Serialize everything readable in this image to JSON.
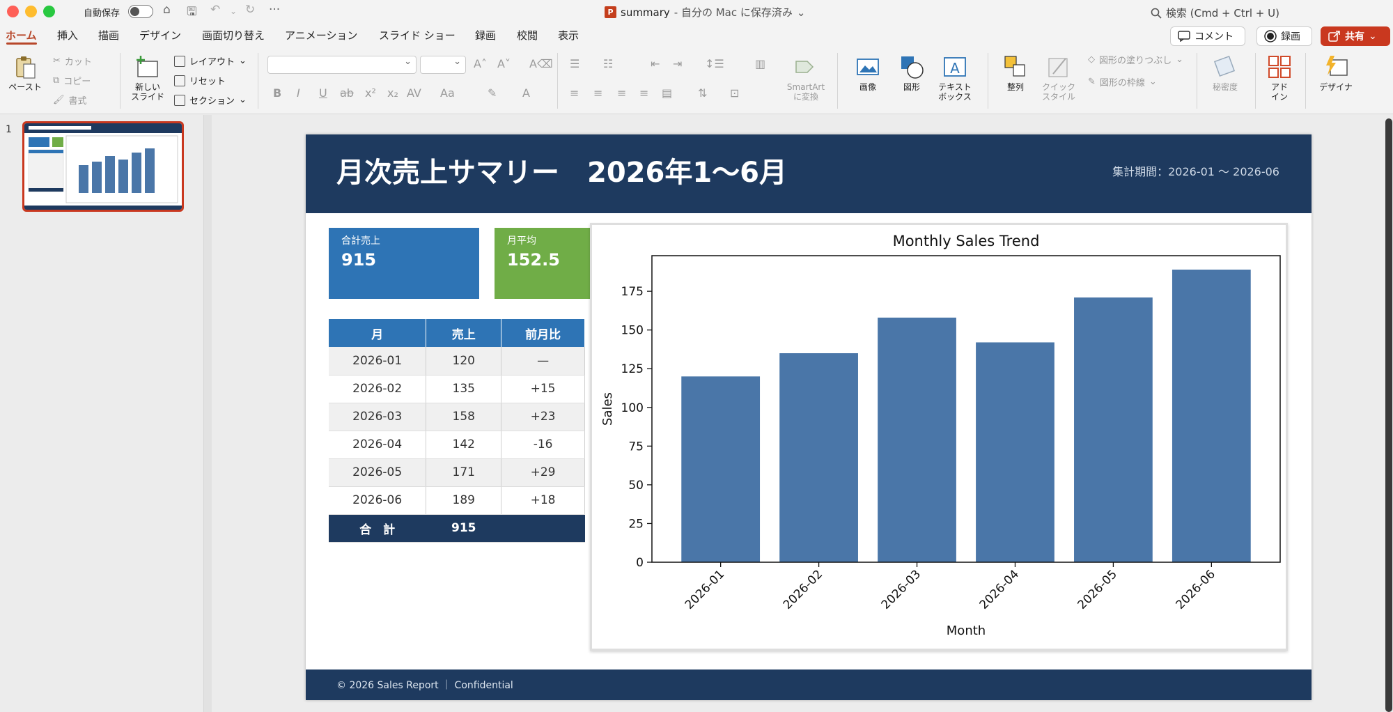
{
  "window": {
    "autosave_label": "自動保存",
    "doc_name": "summary",
    "doc_status": "- 自分の Mac に保存済み",
    "search_placeholder": "検索 (Cmd + Ctrl + U)"
  },
  "tabs": [
    "ホーム",
    "挿入",
    "描画",
    "デザイン",
    "画面切り替え",
    "アニメーション",
    "スライド ショー",
    "録画",
    "校閲",
    "表示"
  ],
  "top_buttons": {
    "comment": "コメント",
    "record": "録画",
    "share": "共有"
  },
  "ribbon": {
    "paste": "ペースト",
    "cut": "カット",
    "copy": "コピー",
    "format": "書式",
    "new_slide_1": "新しい",
    "new_slide_2": "スライド",
    "layout": "レイアウト",
    "reset": "リセット",
    "section": "セクション",
    "smartart_1": "SmartArt",
    "smartart_2": "に変換",
    "image": "画像",
    "shape": "図形",
    "textbox_1": "テキスト",
    "textbox_2": "ボックス",
    "arrange": "整列",
    "quick_style_1": "クイック",
    "quick_style_2": "スタイル",
    "shape_fill": "図形の塗りつぶし",
    "shape_outline": "図形の枠線",
    "sensitivity": "秘密度",
    "addin_1": "アド",
    "addin_2": "イン",
    "designer": "デザイナ"
  },
  "thumbnail": {
    "number": "1"
  },
  "slide": {
    "title": "月次売上サマリー　2026年1〜6月",
    "period": "集計期間：2026-01 〜 2026-06",
    "kpi_total_label": "合計売上",
    "kpi_total_value": "915",
    "kpi_avg_label": "月平均",
    "kpi_avg_value": "152.5",
    "table": {
      "headers": [
        "月",
        "売上",
        "前月比"
      ],
      "rows": [
        {
          "month": "2026-01",
          "sales": "120",
          "change": "—",
          "tone": "neu"
        },
        {
          "month": "2026-02",
          "sales": "135",
          "change": "+15",
          "tone": "pos"
        },
        {
          "month": "2026-03",
          "sales": "158",
          "change": "+23",
          "tone": "pos"
        },
        {
          "month": "2026-04",
          "sales": "142",
          "change": "-16",
          "tone": "neg"
        },
        {
          "month": "2026-05",
          "sales": "171",
          "change": "+29",
          "tone": "pos"
        },
        {
          "month": "2026-06",
          "sales": "189",
          "change": "+18",
          "tone": "pos"
        }
      ],
      "total_label": "合　計",
      "total_value": "915"
    },
    "footer": "© 2026 Sales Report ｜ Confidential"
  },
  "colors": {
    "header_navy": "#1e3a5f",
    "kpi_blue": "#2e74b5",
    "kpi_green": "#70ad47",
    "bar_blue": "#4a76a8",
    "accent_red": "#c9381f"
  },
  "chart_data": {
    "type": "bar",
    "title": "Monthly Sales Trend",
    "xlabel": "Month",
    "ylabel": "Sales",
    "categories": [
      "2026-01",
      "2026-02",
      "2026-03",
      "2026-04",
      "2026-05",
      "2026-06"
    ],
    "values": [
      120,
      135,
      158,
      142,
      171,
      189
    ],
    "ylim": [
      0,
      198
    ],
    "yticks": [
      0,
      25,
      50,
      75,
      100,
      125,
      150,
      175
    ],
    "grid": false
  }
}
